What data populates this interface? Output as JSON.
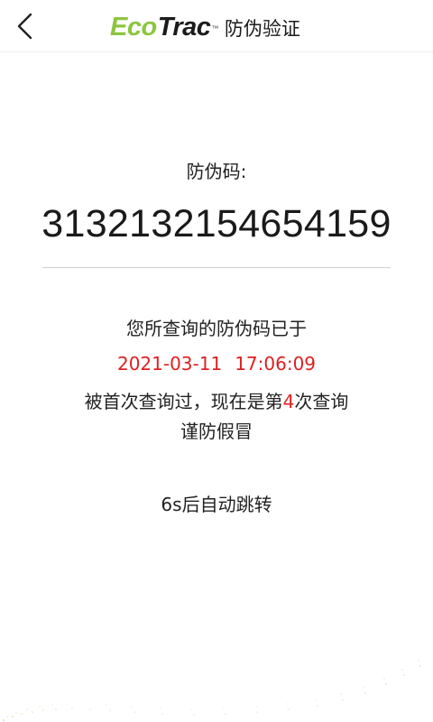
{
  "header": {
    "back_icon": "chevron-left-icon",
    "brand_eco": "Eco",
    "brand_trac": "Trac",
    "brand_tm": "™",
    "title": "防伪验证",
    "brand_color": "#8cc63f"
  },
  "verification": {
    "code_label": "防伪码:",
    "code_value": "3132132154654159",
    "message_line1": "您所查询的防伪码已于",
    "query_date": "2021-03-11",
    "query_time": "17:06:09",
    "message_line3_prefix": "被首次查询过，现在是第",
    "query_count": "4",
    "message_line3_suffix": "次查询",
    "message_line4": "谨防假冒",
    "countdown_text": "6s后自动跳转",
    "highlight_color": "#e02020"
  }
}
